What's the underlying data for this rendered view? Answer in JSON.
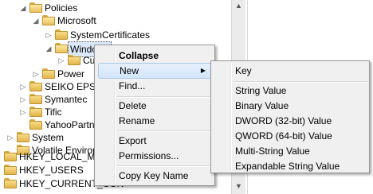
{
  "tree": {
    "policies": "Policies",
    "microsoft": "Microsoft",
    "system_certificates": "SystemCertificates",
    "windows": "Windows",
    "cur": "Cur",
    "power": "Power",
    "seiko_epson": "SEIKO EPSON",
    "symantec": "Symantec",
    "tific": "Tific",
    "yahoo_partner": "YahooPartnerT",
    "system": "System",
    "volatile_environment": "Volatile Environm",
    "hkey_local_machine": "HKEY_LOCAL_MACHI",
    "hkey_users": "HKEY_USERS",
    "hkey_current_config": "HKEY_CURRENT_CON"
  },
  "context_menu": {
    "collapse": "Collapse",
    "new": "New",
    "find": "Find...",
    "delete": "Delete",
    "rename": "Rename",
    "export": "Export",
    "permissions": "Permissions...",
    "copy_key_name": "Copy Key Name"
  },
  "new_submenu": {
    "key": "Key",
    "string_value": "String Value",
    "binary_value": "Binary Value",
    "dword_value": "DWORD (32-bit) Value",
    "qword_value": "QWORD (64-bit) Value",
    "multi_string_value": "Multi-String Value",
    "expandable_string_value": "Expandable String Value"
  },
  "colors": {
    "menu_background": "#f0f0f0",
    "highlight": "#d3e5fa",
    "folder": "#e3b54b"
  }
}
